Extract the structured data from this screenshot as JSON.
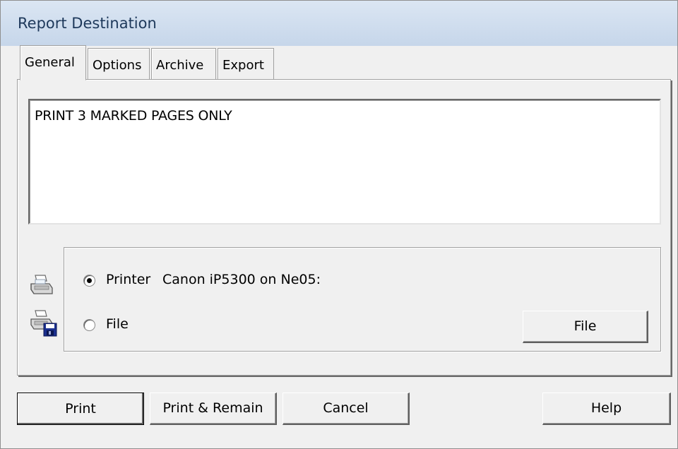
{
  "window": {
    "title": "Report Destination"
  },
  "tabs": [
    {
      "label": "General",
      "active": true
    },
    {
      "label": "Options",
      "active": false
    },
    {
      "label": "Archive",
      "active": false
    },
    {
      "label": "Export",
      "active": false
    }
  ],
  "general": {
    "report_text": "PRINT 3 MARKED PAGES ONLY",
    "destination": {
      "selected": "Printer",
      "printer_option_label": "Printer",
      "printer_name": "Canon iP5300 on Ne05:",
      "file_option_label": "File",
      "file_button_label": "File"
    }
  },
  "buttons": {
    "print": "Print",
    "print_remain": "Print & Remain",
    "cancel": "Cancel",
    "help": "Help"
  },
  "icons": {
    "printer": "printer-icon",
    "printer_file": "printer-disk-icon"
  }
}
